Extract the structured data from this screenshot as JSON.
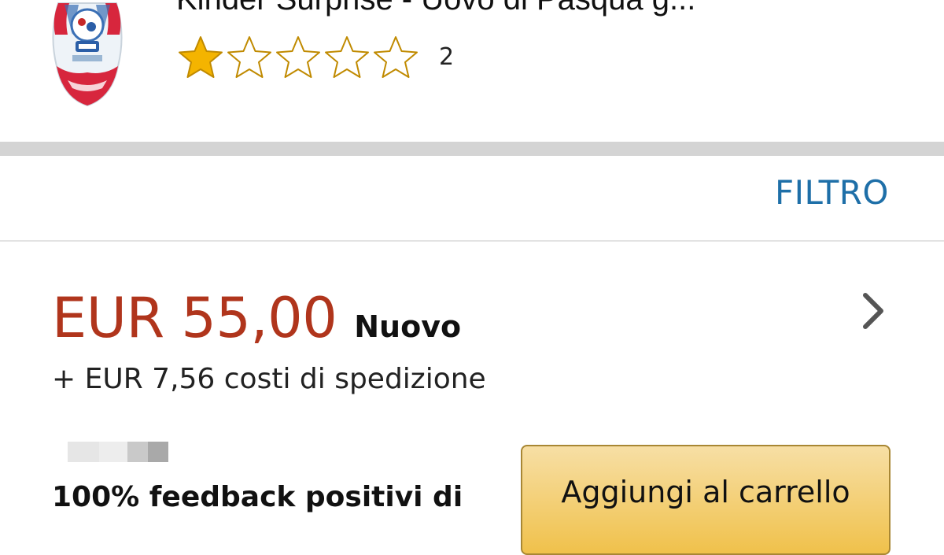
{
  "product": {
    "title": "Kinder Surprise - Uovo di Pasqua g...",
    "image_icon": "kinder-egg-thumbnail",
    "rating": {
      "value": 1,
      "max": 5,
      "count": "2"
    }
  },
  "filter": {
    "label": "FILTRO"
  },
  "offer": {
    "price": "EUR 55,00",
    "condition": "Nuovo",
    "shipping": "+ EUR 7,56 costi di spedizione",
    "seller_feedback": "100% feedback positivi di",
    "add_to_cart_label": "Aggiungi al carrello",
    "details_icon": "chevron-right-icon"
  },
  "colors": {
    "price": "#b0351c",
    "link": "#1e6fa8",
    "star_filled": "#f4b400",
    "star_outline": "#c08a00",
    "button_top": "#f7dfa5",
    "button_bottom": "#f0c14b",
    "divider": "#d4d4d4"
  }
}
